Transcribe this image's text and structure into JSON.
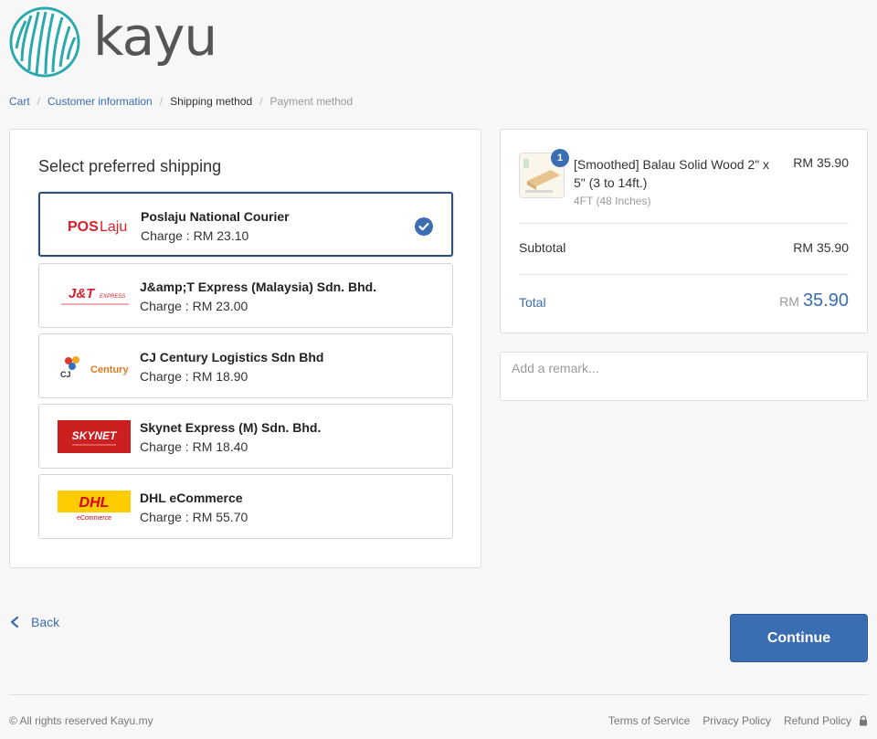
{
  "brand": {
    "name": "kayu"
  },
  "breadcrumb": [
    {
      "label": "Cart",
      "state": "link"
    },
    {
      "label": "Customer information",
      "state": "link"
    },
    {
      "label": "Shipping method",
      "state": "current"
    },
    {
      "label": "Payment method",
      "state": "disabled"
    }
  ],
  "shipping": {
    "title": "Select preferred shipping",
    "options": [
      {
        "name": "Poslaju National Courier",
        "charge": "Charge : RM 23.10",
        "selected": true,
        "logo": "poslaju-logo"
      },
      {
        "name": "J&amp;T Express (Malaysia) Sdn. Bhd.",
        "charge": "Charge : RM 23.00",
        "selected": false,
        "logo": "jnt-express-logo"
      },
      {
        "name": "CJ Century Logistics Sdn Bhd",
        "charge": "Charge : RM 18.90",
        "selected": false,
        "logo": "cj-century-logo"
      },
      {
        "name": "Skynet Express (M) Sdn. Bhd.",
        "charge": "Charge : RM 18.40",
        "selected": false,
        "logo": "skynet-logo"
      },
      {
        "name": "DHL eCommerce",
        "charge": "Charge : RM 55.70",
        "selected": false,
        "logo": "dhl-ecommerce-logo"
      }
    ],
    "logo_text": {
      "poslaju": "POS Laju",
      "jnt": "J&T",
      "jnt_sub": "EXPRESS",
      "cj": "CJ",
      "century": "Century",
      "skynet": "SKYNET",
      "dhl": "DHL",
      "dhl_sub": "eCommerce"
    }
  },
  "summary": {
    "product": {
      "quantity": "1",
      "name": "[Smoothed] Balau Solid Wood 2\" x 5\" (3 to 14ft.)",
      "variant": "4FT (48 Inches)",
      "price": "RM 35.90"
    },
    "subtotal_label": "Subtotal",
    "subtotal_value": "RM 35.90",
    "total_label": "Total",
    "total_currency": "RM",
    "total_amount": "35.90"
  },
  "remark": {
    "placeholder": "Add a remark..."
  },
  "actions": {
    "back_label": "Back",
    "continue_label": "Continue"
  },
  "footer": {
    "copyright": "© All rights reserved Kayu.my",
    "links": [
      "Terms of Service",
      "Privacy Policy",
      "Refund Policy"
    ]
  },
  "colors": {
    "accent": "#3b6db2",
    "selected_border": "#2d4f73",
    "logo_teal": "#2aa9ae"
  }
}
